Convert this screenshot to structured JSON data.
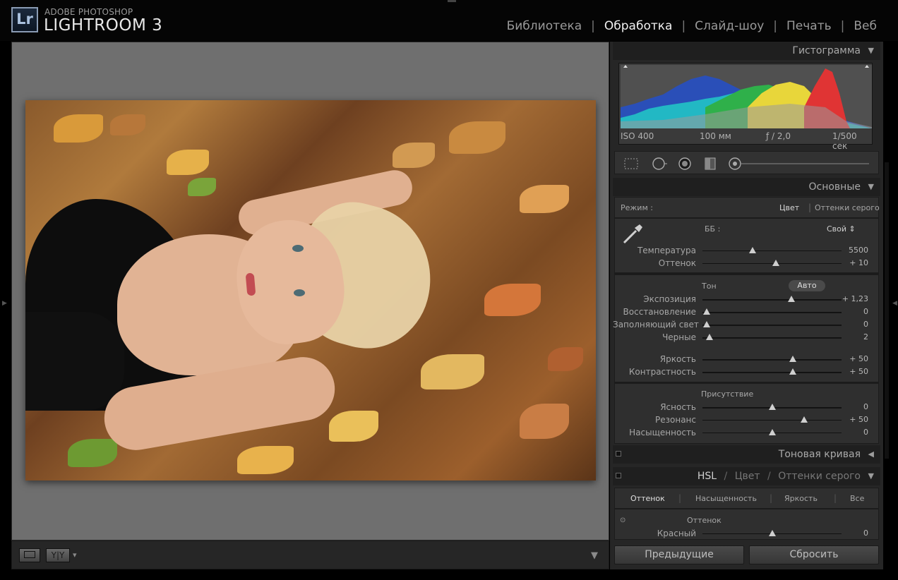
{
  "app": {
    "logo_letters": "Lr",
    "brand_small": "ADOBE PHOTOSHOP",
    "brand_big": "LIGHTROOM 3"
  },
  "modules": [
    {
      "label": "Библиотека",
      "active": false
    },
    {
      "label": "Обработка",
      "active": true
    },
    {
      "label": "Слайд-шоу",
      "active": false
    },
    {
      "label": "Печать",
      "active": false
    },
    {
      "label": "Веб",
      "active": false
    }
  ],
  "histogram": {
    "title": "Гистограмма",
    "iso": "ISO 400",
    "focal": "100 мм",
    "aperture": "ƒ / 2,0",
    "shutter": "1/500 сек"
  },
  "basic": {
    "title": "Основные",
    "mode_label": "Режим :",
    "mode_color": "Цвет",
    "mode_gray": "Оттенки серого",
    "wb_label": "ББ :",
    "wb_value": "Свой ⇕",
    "temperature": {
      "label": "Температура",
      "value": "5500",
      "pos": 0.36
    },
    "tint": {
      "label": "Оттенок",
      "value": "+ 10",
      "pos": 0.53
    },
    "tone_label": "Тон",
    "auto_label": "Авто",
    "exposure": {
      "label": "Экспозиция",
      "value": "+ 1,23",
      "pos": 0.64
    },
    "recovery": {
      "label": "Восстановление",
      "value": "0",
      "pos": 0.03
    },
    "fill": {
      "label": "Заполняющий свет",
      "value": "0",
      "pos": 0.03
    },
    "blacks": {
      "label": "Черные",
      "value": "2",
      "pos": 0.05
    },
    "brightness": {
      "label": "Яркость",
      "value": "+ 50",
      "pos": 0.65
    },
    "contrast": {
      "label": "Контрастность",
      "value": "+ 50",
      "pos": 0.65
    },
    "presence_label": "Присутствие",
    "clarity": {
      "label": "Ясность",
      "value": "0",
      "pos": 0.5
    },
    "vibrance": {
      "label": "Резонанс",
      "value": "+ 50",
      "pos": 0.73
    },
    "saturation": {
      "label": "Насыщенность",
      "value": "0",
      "pos": 0.5
    }
  },
  "tone_curve": {
    "title": "Тоновая кривая"
  },
  "hsl": {
    "title_hsl": "HSL",
    "sep": "/",
    "title_color": "Цвет",
    "title_gray": "Оттенки серого",
    "tabs": [
      "Оттенок",
      "Насыщенность",
      "Яркость",
      "Все"
    ],
    "group_label": "Оттенок",
    "red": {
      "label": "Красный",
      "value": "0",
      "pos": 0.5
    }
  },
  "buttons": {
    "previous": "Предыдущие",
    "reset": "Сбросить"
  },
  "toolbar": {
    "compare_label": "Y|Y"
  }
}
